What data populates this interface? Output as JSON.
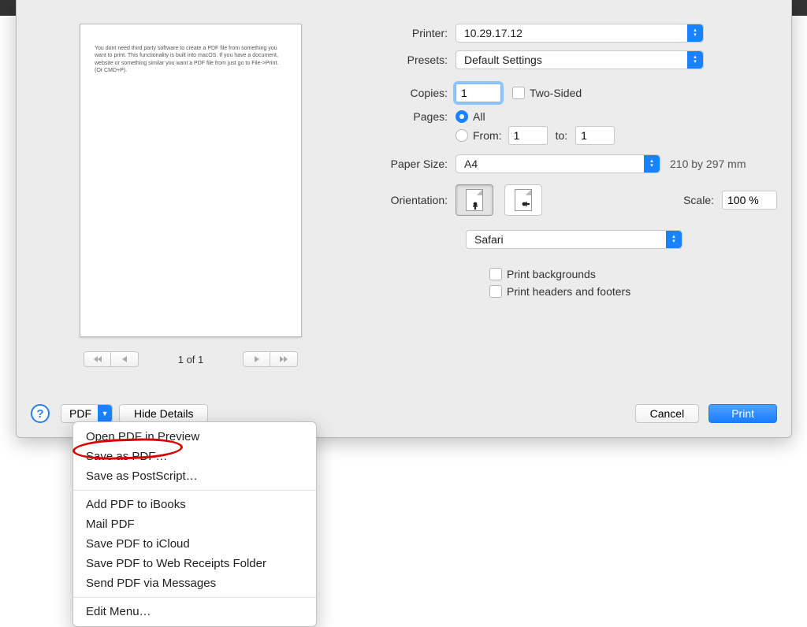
{
  "preview": {
    "text": "You dont need third party software to create a PDF file from something you want to print. This functionality is built into macOS. If you have a document, website or something similar you want a PDF file from just go to File->Print. (Or CMD+P).",
    "page_indicator": "1 of 1"
  },
  "form": {
    "printer_label": "Printer:",
    "printer_value": "10.29.17.12",
    "presets_label": "Presets:",
    "presets_value": "Default Settings",
    "copies_label": "Copies:",
    "copies_value": "1",
    "two_sided_label": "Two-Sided",
    "pages_label": "Pages:",
    "pages_all": "All",
    "pages_from_label": "From:",
    "pages_from_value": "1",
    "pages_to_label": "to:",
    "pages_to_value": "1",
    "paper_size_label": "Paper Size:",
    "paper_size_value": "A4",
    "paper_size_note": "210 by 297 mm",
    "orientation_label": "Orientation:",
    "scale_label": "Scale:",
    "scale_value": "100 %",
    "app_dropdown": "Safari",
    "print_backgrounds": "Print backgrounds",
    "print_headers": "Print headers and footers"
  },
  "bottom": {
    "pdf_button": "PDF",
    "hide_details": "Hide Details",
    "cancel": "Cancel",
    "print": "Print",
    "help": "?"
  },
  "menu": {
    "items": [
      "Open PDF in Preview",
      "Save as PDF…",
      "Save as PostScript…"
    ],
    "items2": [
      "Add PDF to iBooks",
      "Mail PDF",
      "Save PDF to iCloud",
      "Save PDF to Web Receipts Folder",
      "Send PDF via Messages"
    ],
    "items3": [
      "Edit Menu…"
    ]
  },
  "nav": {
    "first": "≪",
    "prev": "⟨",
    "next": "⟩",
    "last": "≫"
  }
}
